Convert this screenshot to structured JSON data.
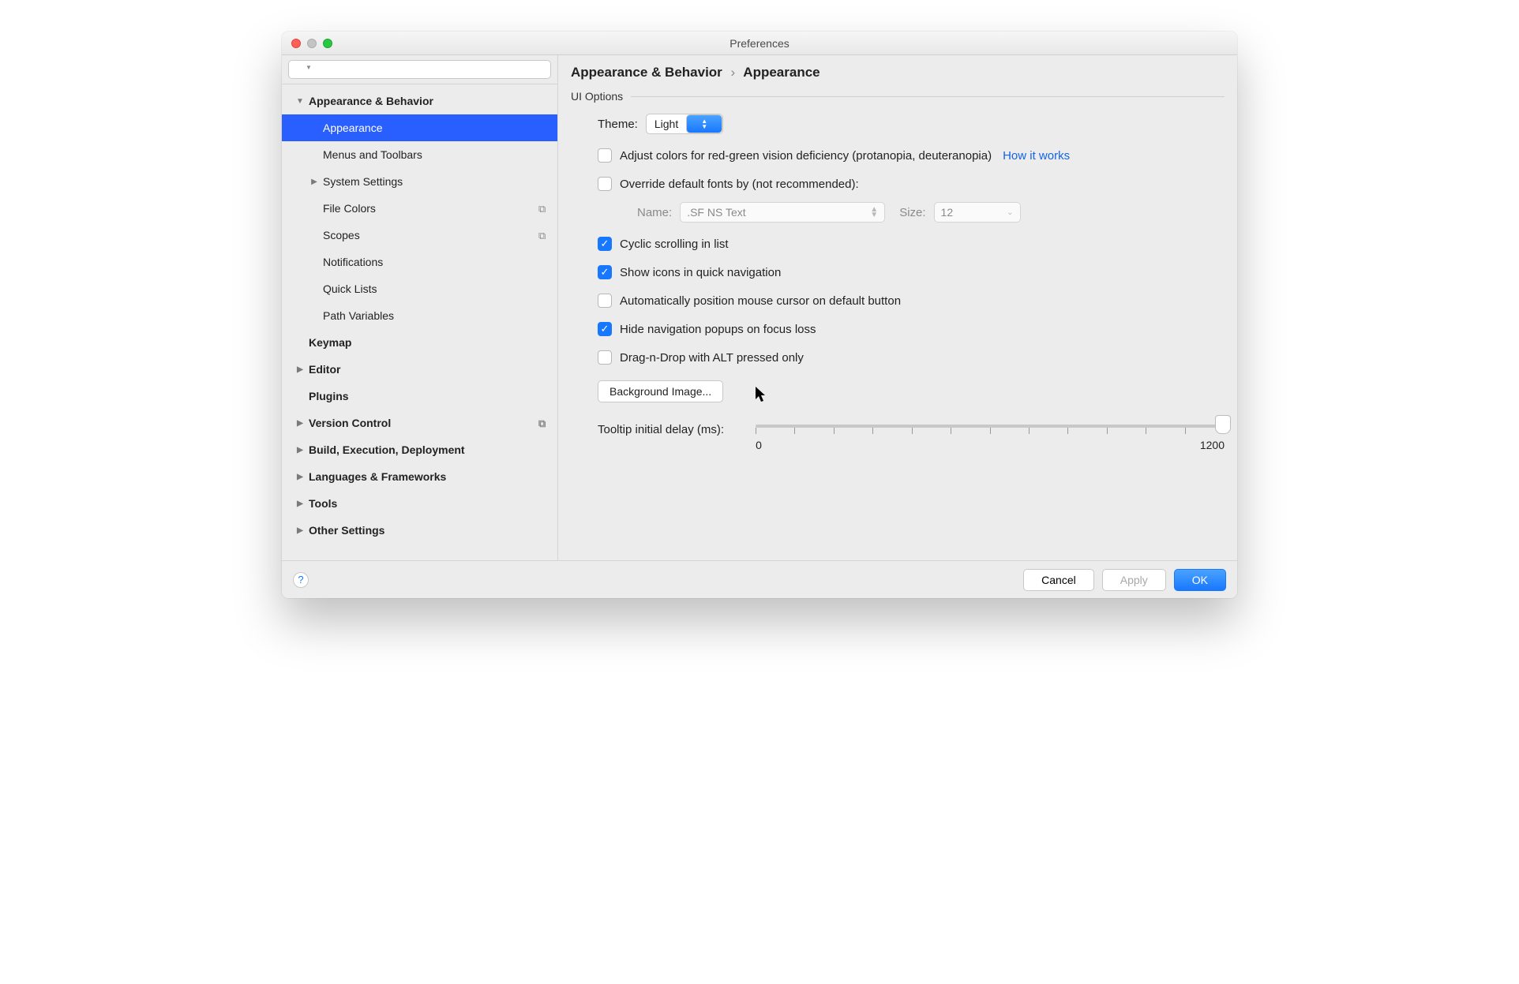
{
  "window": {
    "title": "Preferences"
  },
  "search": {
    "placeholder": ""
  },
  "sidebar": {
    "top": "Appearance & Behavior",
    "items": [
      "Appearance",
      "Menus and Toolbars",
      "System Settings",
      "File Colors",
      "Scopes",
      "Notifications",
      "Quick Lists",
      "Path Variables"
    ],
    "sections": [
      "Keymap",
      "Editor",
      "Plugins",
      "Version Control",
      "Build, Execution, Deployment",
      "Languages & Frameworks",
      "Tools",
      "Other Settings"
    ]
  },
  "breadcrumb": {
    "a": "Appearance & Behavior",
    "b": "Appearance"
  },
  "section": {
    "title": "UI Options"
  },
  "theme": {
    "label": "Theme:",
    "value": "Light"
  },
  "checks": {
    "adjust": "Adjust colors for red-green vision deficiency (protanopia, deuteranopia)",
    "how": "How it works",
    "override": "Override default fonts by (not recommended):",
    "font_name_label": "Name:",
    "font_name_value": ".SF NS Text",
    "font_size_label": "Size:",
    "font_size_value": "12",
    "cyclic": "Cyclic scrolling in list",
    "quicknav": "Show icons in quick navigation",
    "mouse": "Automatically position mouse cursor on default button",
    "hide": "Hide navigation popups on focus loss",
    "drag": "Drag-n-Drop with ALT pressed only"
  },
  "bg_button": "Background Image...",
  "tooltip": {
    "label": "Tooltip initial delay (ms):",
    "min": "0",
    "max": "1200"
  },
  "footer": {
    "cancel": "Cancel",
    "apply": "Apply",
    "ok": "OK"
  }
}
